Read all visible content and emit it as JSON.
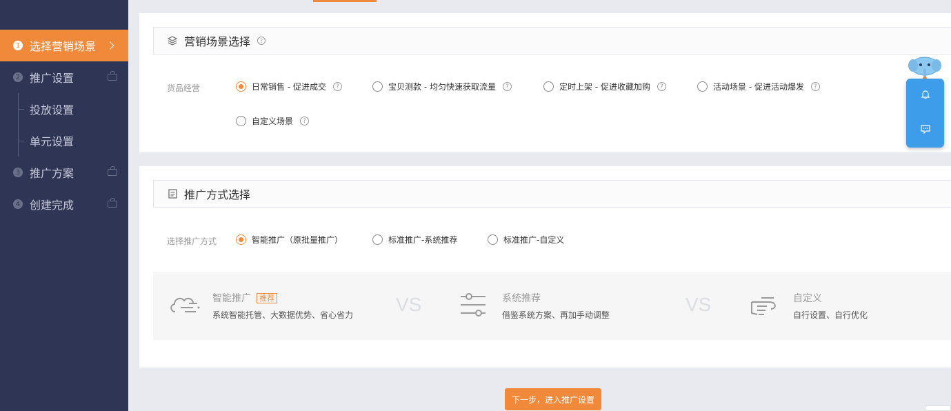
{
  "sidebar": {
    "steps": [
      {
        "num": "1",
        "label": "选择营销场景"
      },
      {
        "num": "2",
        "label": "推广设置"
      },
      {
        "num": "3",
        "label": "推广方案"
      },
      {
        "num": "4",
        "label": "创建完成"
      }
    ],
    "substeps": [
      "投放设置",
      "单元设置"
    ]
  },
  "scene_card": {
    "title": "营销场景选择",
    "field_label": "货品经营",
    "options": [
      {
        "label": "日常销售 - 促进成交",
        "checked": true
      },
      {
        "label": "宝贝测款 - 均匀快速获取流量",
        "checked": false
      },
      {
        "label": "定时上架 - 促进收藏加购",
        "checked": false
      },
      {
        "label": "活动场景 - 促进活动爆发",
        "checked": false
      },
      {
        "label": "自定义场景",
        "checked": false
      }
    ]
  },
  "method_card": {
    "title": "推广方式选择",
    "field_label": "选择推广方式",
    "options": [
      {
        "label": "智能推广（原批量推广）",
        "checked": true
      },
      {
        "label": "标准推广-系统推荐",
        "checked": false
      },
      {
        "label": "标准推广-自定义",
        "checked": false
      }
    ],
    "compare": {
      "items": [
        {
          "title": "智能推广",
          "badge": "推荐",
          "desc": "系统智能托管、大数据优势、省心省力",
          "icon": "cloud-icon"
        },
        {
          "title": "系统推荐",
          "desc": "借鉴系统方案、再加手动调整",
          "icon": "sliders-icon"
        },
        {
          "title": "自定义",
          "desc": "自行设置、自行优化",
          "icon": "hand-icon"
        }
      ],
      "vs": "VS"
    }
  },
  "next_button": "下一步，进入推广设置",
  "colors": {
    "accent": "#f0893a",
    "sidebar": "#2f3554",
    "float": "#3e9dea"
  }
}
